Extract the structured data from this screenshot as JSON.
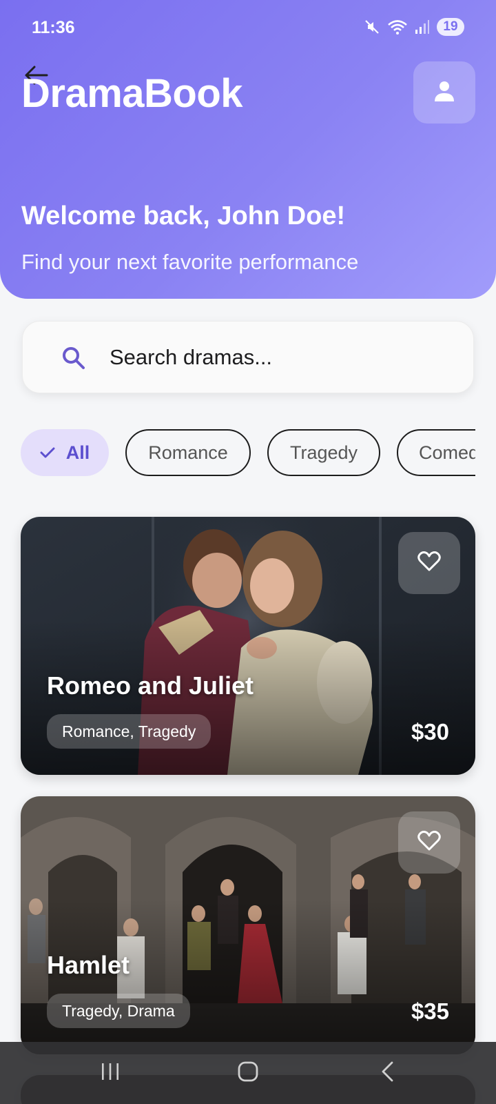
{
  "status_bar": {
    "time": "11:36",
    "battery": "19"
  },
  "header": {
    "title": "DramaBook",
    "welcome": "Welcome back, John Doe!",
    "subtitle": "Find your next favorite performance"
  },
  "search": {
    "placeholder": "Search dramas..."
  },
  "filters": {
    "chips": [
      {
        "label": "All",
        "active": true
      },
      {
        "label": "Romance",
        "active": false
      },
      {
        "label": "Tragedy",
        "active": false
      },
      {
        "label": "Comedy",
        "active": false
      }
    ]
  },
  "dramas": [
    {
      "title": "Romeo and Juliet",
      "genres": "Romance, Tragedy",
      "price": "$30"
    },
    {
      "title": "Hamlet",
      "genres": "Tragedy, Drama",
      "price": "$35"
    }
  ],
  "colors": {
    "accent": "#7a6ff0",
    "chip_active_bg": "#e4defb",
    "chip_active_text": "#5c4fcf"
  }
}
